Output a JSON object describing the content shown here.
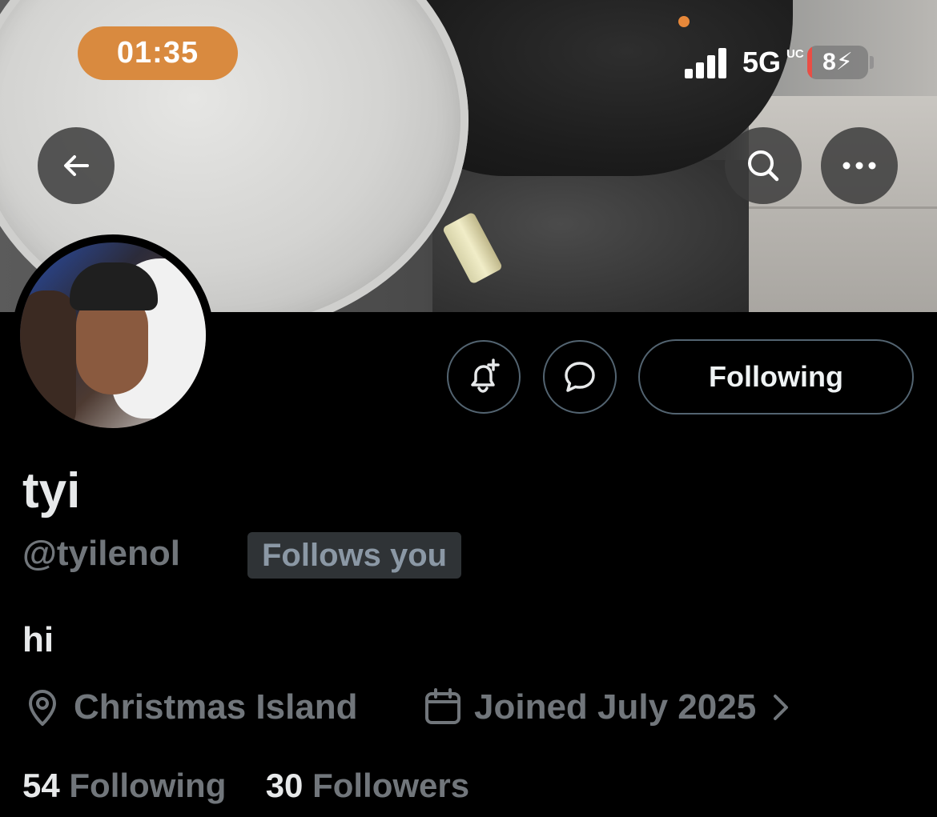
{
  "status_bar": {
    "time": "01:35",
    "network": "5G",
    "network_sub": "UC",
    "battery_level": "8",
    "battery_percent": 8,
    "charging_icon": "bolt-icon"
  },
  "header": {
    "back_icon": "arrow-left-icon",
    "search_icon": "search-icon",
    "more_icon": "ellipsis-icon"
  },
  "actions": {
    "notify_icon": "bell-plus-icon",
    "message_icon": "chat-bubble-icon",
    "follow_label": "Following"
  },
  "profile": {
    "display_name": "tyi",
    "handle": "@tyilenol",
    "follows_you_label": "Follows you",
    "bio": "hi",
    "location": "Christmas Island",
    "joined": "Joined July 2025",
    "following_count": "54",
    "following_label": "Following",
    "followers_count": "30",
    "followers_label": "Followers"
  },
  "colors": {
    "time_pill": "#d98a3f",
    "muted_text": "#71767b",
    "border": "#536471",
    "battery_low": "#ea4e45"
  }
}
